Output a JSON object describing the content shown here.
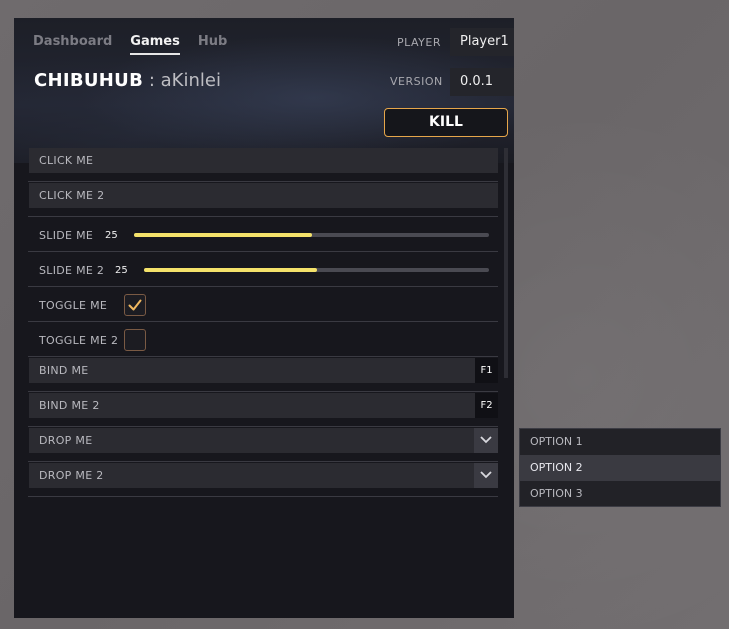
{
  "tabs": [
    "Dashboard",
    "Games",
    "Hub"
  ],
  "active_tab": "Games",
  "title": {
    "brand": "CHIBUHUB",
    "subtitle": ": aKinlei"
  },
  "player": {
    "label": "PLAYER",
    "value": "Player1"
  },
  "version": {
    "label": "VERSION",
    "value": "0.0.1"
  },
  "kill_label": "KILL",
  "controls": {
    "click_me": "CLICK ME",
    "click_me_2": "CLICK ME 2",
    "slide_me": {
      "label": "SLIDE ME",
      "value": "25",
      "fraction": 0.5
    },
    "slide_me_2": {
      "label": "SLIDE ME 2",
      "value": "25",
      "fraction": 0.5
    },
    "toggle_me": {
      "label": "TOGGLE ME",
      "checked": true
    },
    "toggle_me_2": {
      "label": "TOGGLE ME 2",
      "checked": false
    },
    "bind_me": {
      "label": "BIND ME",
      "key": "F1"
    },
    "bind_me_2": {
      "label": "BIND ME 2",
      "key": "F2"
    },
    "drop_me": "DROP ME",
    "drop_me_2": "DROP ME 2"
  },
  "dropdown": {
    "options": [
      "OPTION 1",
      "OPTION 2",
      "OPTION 3"
    ],
    "highlighted": "OPTION 2"
  },
  "colors": {
    "accent_fill": "#f4e26a",
    "kill_border": "#e6a64a",
    "check": "#f0b860"
  }
}
